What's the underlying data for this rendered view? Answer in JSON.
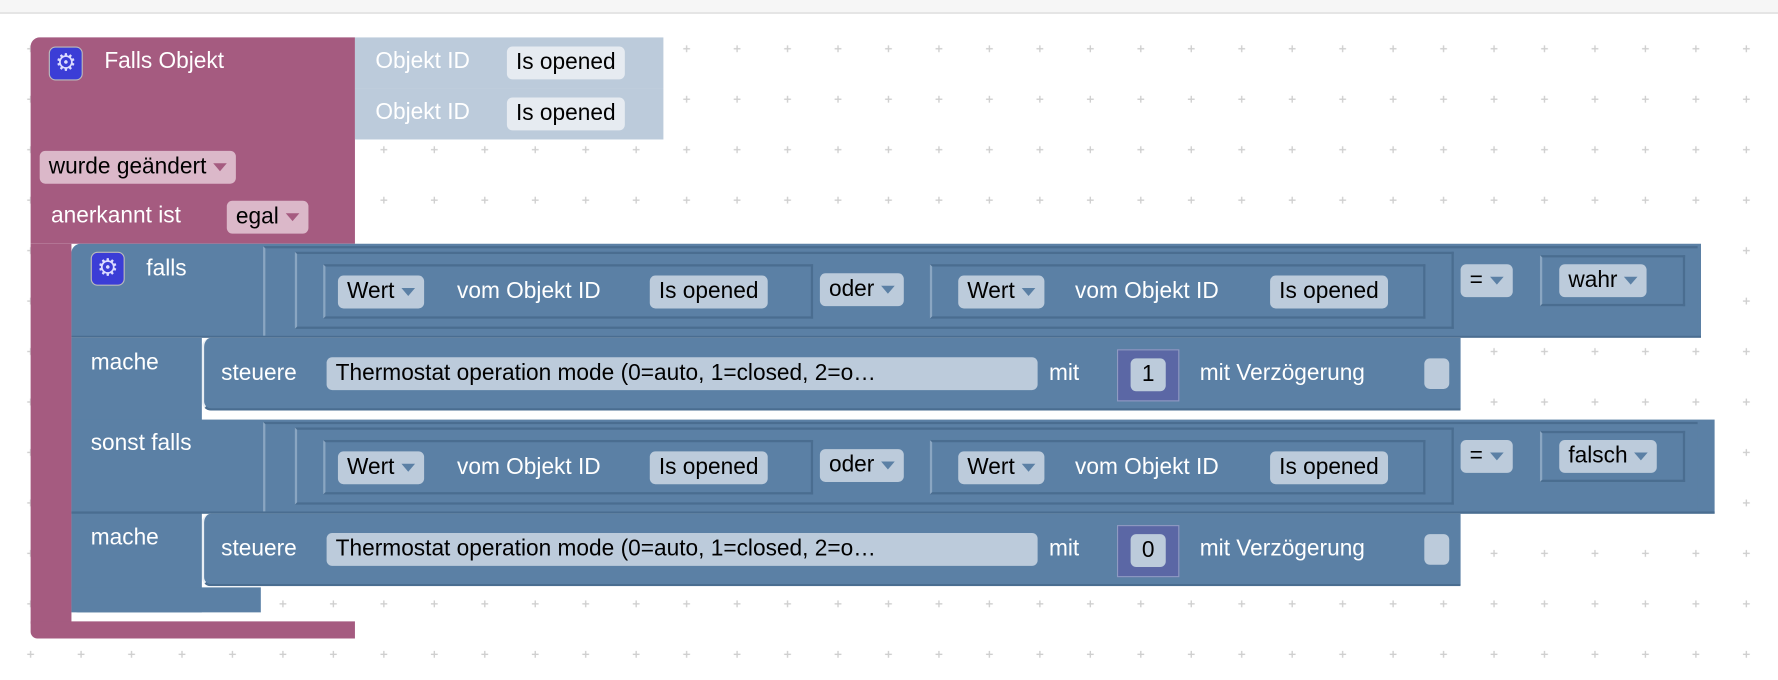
{
  "colors": {
    "trigger_block": "#a55b80",
    "logic_block": "#5b80a5",
    "object_block": "#bccbdb",
    "number_block": "#5b67a5",
    "gear_icon": "#3b3dd6"
  },
  "trigger": {
    "title": "Falls Objekt",
    "objects": [
      {
        "label": "Objekt ID",
        "value": "Is opened"
      },
      {
        "label": "Objekt ID",
        "value": "Is opened"
      }
    ],
    "condition": "wurde geändert",
    "ack_label": "anerkannt ist",
    "ack_value": "egal"
  },
  "if_block": {
    "if_label": "falls",
    "do_label": "mache",
    "elseif_label": "sonst falls",
    "branches": [
      {
        "left": {
          "mode": "Wert",
          "text": "vom Objekt ID",
          "object": "Is opened"
        },
        "operator": "oder",
        "right": {
          "mode": "Wert",
          "text": "vom Objekt ID",
          "object": "Is opened"
        },
        "compare": "=",
        "bool": "wahr",
        "action": {
          "label": "steuere",
          "target": "Thermostat operation mode (0=auto, 1=closed, 2=o…",
          "with": "mit",
          "value": "1",
          "delay_label": "mit Verzögerung",
          "delay_checked": false
        }
      },
      {
        "left": {
          "mode": "Wert",
          "text": "vom Objekt ID",
          "object": "Is opened"
        },
        "operator": "oder",
        "right": {
          "mode": "Wert",
          "text": "vom Objekt ID",
          "object": "Is opened"
        },
        "compare": "=",
        "bool": "falsch",
        "action": {
          "label": "steuere",
          "target": "Thermostat operation mode (0=auto, 1=closed, 2=o…",
          "with": "mit",
          "value": "0",
          "delay_label": "mit Verzögerung",
          "delay_checked": false
        }
      }
    ]
  }
}
